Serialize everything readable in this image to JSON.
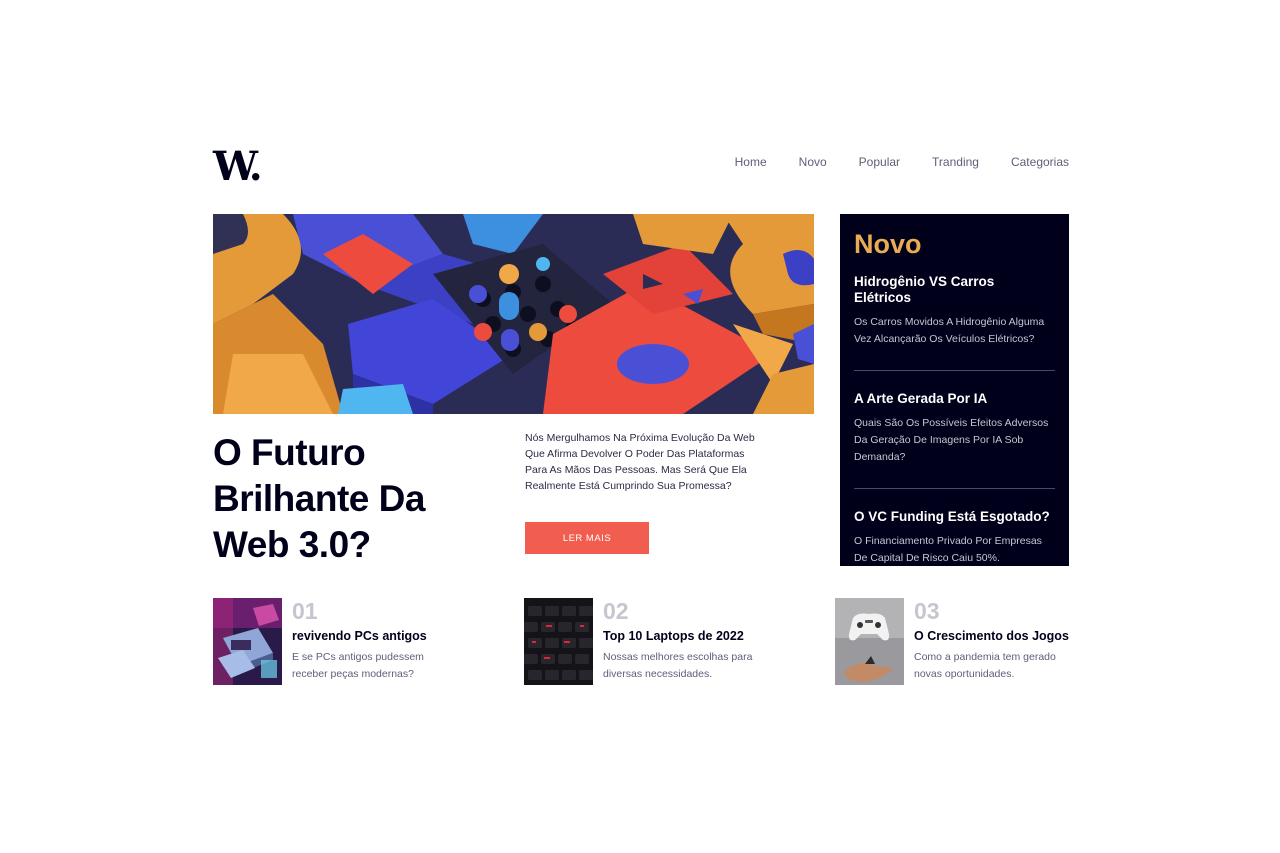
{
  "header": {
    "logo": "W.",
    "nav": [
      "Home",
      "Novo",
      "Popular",
      "Tranding",
      "Categorias"
    ]
  },
  "hero": {
    "image_icon": "abstract-3d-blocks-image",
    "title": "O Futuro Brilhante Da Web 3.0?",
    "description": "Nós Mergulhamos Na Próxima Evolução Da Web Que Afirma Devolver O Poder Das Plataformas Para As Mãos Das Pessoas. Mas Será Que Ela Realmente Está Cumprindo Sua Promessa?",
    "button_label": "LER MAIS"
  },
  "new_panel": {
    "title": "Novo",
    "items": [
      {
        "title": "Hidrogênio VS Carros Elétricos",
        "description": "Os Carros Movidos A Hidrogênio Alguma Vez Alcançarão Os Veículos Elétricos?"
      },
      {
        "title": "A Arte Gerada Por IA",
        "description": "Quais São Os Possíveis Efeitos Adversos Da Geração De Imagens Por IA Sob Demanda?"
      },
      {
        "title": "O VC Funding Está Esgotado?",
        "description": "O Financiamento Privado Por Empresas De Capital De Risco Caiu 50%."
      }
    ]
  },
  "articles": [
    {
      "number": "01",
      "title": "revivendo PCs antigos",
      "description": "E se PCs antigos pudessem receber peças modernas?",
      "image_icon": "retro-pc-image"
    },
    {
      "number": "02",
      "title": "Top 10 Laptops de 2022",
      "description": "Nossas melhores escolhas para diversas necessidades.",
      "image_icon": "keyboard-image"
    },
    {
      "number": "03",
      "title": "O Crescimento dos Jogos",
      "description": "Como a pandemia tem gerado novas oportunidades.",
      "image_icon": "game-controller-image"
    }
  ],
  "colors": {
    "accent": "#f15e50",
    "panel_bg": "#00001a",
    "panel_title": "#e9ab53",
    "muted": "#c5c6d0",
    "text_secondary": "#5d5f79"
  }
}
